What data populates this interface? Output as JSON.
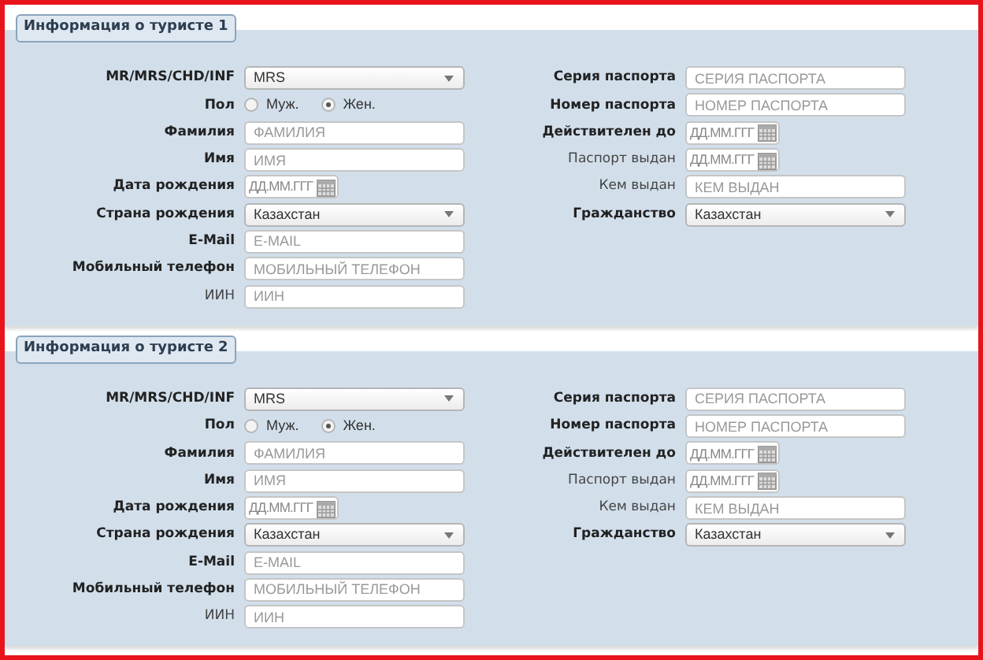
{
  "sections": [
    {
      "title": "Информация о туристе 1",
      "left": [
        {
          "label": "MR/MRS/CHD/INF",
          "bold": true,
          "kind": "select",
          "value": "MRS"
        },
        {
          "label": "Пол",
          "bold": true,
          "kind": "radio",
          "options": [
            {
              "label": "Муж.",
              "selected": false
            },
            {
              "label": "Жен.",
              "selected": true
            }
          ]
        },
        {
          "label": "Фамилия",
          "bold": true,
          "kind": "text",
          "placeholder": "ФАМИЛИЯ"
        },
        {
          "label": "Имя",
          "bold": true,
          "kind": "text",
          "placeholder": "ИМЯ"
        },
        {
          "label": "Дата рождения",
          "bold": true,
          "kind": "date",
          "placeholder": "ДД.ММ.ГГГ"
        },
        {
          "label": "Страна рождения",
          "bold": true,
          "kind": "select",
          "value": "Казахстан"
        },
        {
          "label": "E-Mail",
          "bold": true,
          "kind": "text",
          "placeholder": "E-MAIL"
        },
        {
          "label": "Мобильный телефон",
          "bold": true,
          "kind": "text",
          "placeholder": "МОБИЛЬНЫЙ ТЕЛЕФОН"
        },
        {
          "label": "ИИН",
          "bold": false,
          "kind": "text",
          "placeholder": "ИИН"
        }
      ],
      "right": [
        {
          "label": "Серия паспорта",
          "bold": true,
          "kind": "text",
          "placeholder": "СЕРИЯ ПАСПОРТА"
        },
        {
          "label": "Номер паспорта",
          "bold": true,
          "kind": "text",
          "placeholder": "НОМЕР ПАСПОРТА"
        },
        {
          "label": "Действителен до",
          "bold": true,
          "kind": "date",
          "placeholder": "ДД.ММ.ГГГ"
        },
        {
          "label": "Паспорт выдан",
          "bold": false,
          "kind": "date",
          "placeholder": "ДД.ММ.ГГГ"
        },
        {
          "label": "Кем выдан",
          "bold": false,
          "kind": "text",
          "placeholder": "КЕМ ВЫДАН"
        },
        {
          "label": "Гражданство",
          "bold": true,
          "kind": "select",
          "value": "Казахстан"
        }
      ]
    },
    {
      "title": "Информация о туристе 2",
      "left": [
        {
          "label": "MR/MRS/CHD/INF",
          "bold": true,
          "kind": "select",
          "value": "MRS"
        },
        {
          "label": "Пол",
          "bold": true,
          "kind": "radio",
          "options": [
            {
              "label": "Муж.",
              "selected": false
            },
            {
              "label": "Жен.",
              "selected": true
            }
          ]
        },
        {
          "label": "Фамилия",
          "bold": true,
          "kind": "text",
          "placeholder": "ФАМИЛИЯ"
        },
        {
          "label": "Имя",
          "bold": true,
          "kind": "text",
          "placeholder": "ИМЯ"
        },
        {
          "label": "Дата рождения",
          "bold": true,
          "kind": "date",
          "placeholder": "ДД.ММ.ГГГ"
        },
        {
          "label": "Страна рождения",
          "bold": true,
          "kind": "select",
          "value": "Казахстан"
        },
        {
          "label": "E-Mail",
          "bold": true,
          "kind": "text",
          "placeholder": "E-MAIL"
        },
        {
          "label": "Мобильный телефон",
          "bold": true,
          "kind": "text",
          "placeholder": "МОБИЛЬНЫЙ ТЕЛЕФОН"
        },
        {
          "label": "ИИН",
          "bold": false,
          "kind": "text",
          "placeholder": "ИИН"
        }
      ],
      "right": [
        {
          "label": "Серия паспорта",
          "bold": true,
          "kind": "text",
          "placeholder": "СЕРИЯ ПАСПОРТА"
        },
        {
          "label": "Номер паспорта",
          "bold": true,
          "kind": "text",
          "placeholder": "НОМЕР ПАСПОРТА"
        },
        {
          "label": "Действителен до",
          "bold": true,
          "kind": "date",
          "placeholder": "ДД.ММ.ГГГ"
        },
        {
          "label": "Паспорт выдан",
          "bold": false,
          "kind": "date",
          "placeholder": "ДД.ММ.ГГГ"
        },
        {
          "label": "Кем выдан",
          "bold": false,
          "kind": "text",
          "placeholder": "КЕМ ВЫДАН"
        },
        {
          "label": "Гражданство",
          "bold": true,
          "kind": "select",
          "value": "Казахстан"
        }
      ]
    }
  ]
}
